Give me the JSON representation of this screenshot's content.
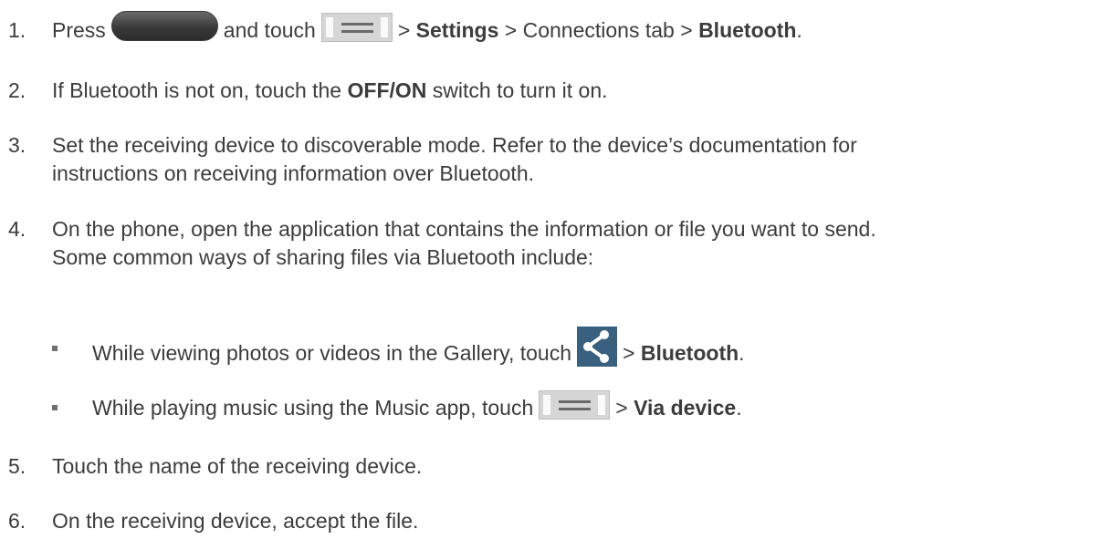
{
  "steps": [
    {
      "number": "1.",
      "press_text": "Press",
      "and_touch_text": "and touch",
      "sep1": ">",
      "settings": "Settings",
      "sep2": ">",
      "connections_text": "Connections tab",
      "sep3": ">",
      "bluetooth": "Bluetooth",
      "end": "."
    },
    {
      "number": "2.",
      "text_before": "If Bluetooth is not on, touch the",
      "switch_label": "OFF/ON",
      "text_after": "switch to turn it on."
    },
    {
      "number": "3.",
      "line1": "Set the receiving device to discoverable mode. Refer to the device’s documentation for",
      "line2": "instructions on receiving information over Bluetooth."
    },
    {
      "number": "4.",
      "line1": "On the phone, open the application that contains the information or file you want to send.",
      "line2": "Some common ways of sharing files via Bluetooth include:"
    },
    {
      "number": "5.",
      "text": "Touch the name of the receiving device."
    },
    {
      "number": "6.",
      "text": "On the receiving device, accept the file."
    }
  ],
  "bullets": [
    {
      "text": "While viewing photos or videos in the Gallery, touch",
      "sep": ">",
      "target": "Bluetooth",
      "end": "."
    },
    {
      "text": "While playing music using the Music app, touch",
      "sep": ">",
      "target": "Via device",
      "end": "."
    }
  ],
  "icons": {
    "home_key": "home-key-icon",
    "menu_key": "menu-key-icon",
    "share": "share-icon"
  },
  "colors": {
    "text": "#3c3c3c",
    "share_bg": "#39607e",
    "home_key": "#3a3a3a",
    "menu_key_bg": "#d6d6d6"
  }
}
